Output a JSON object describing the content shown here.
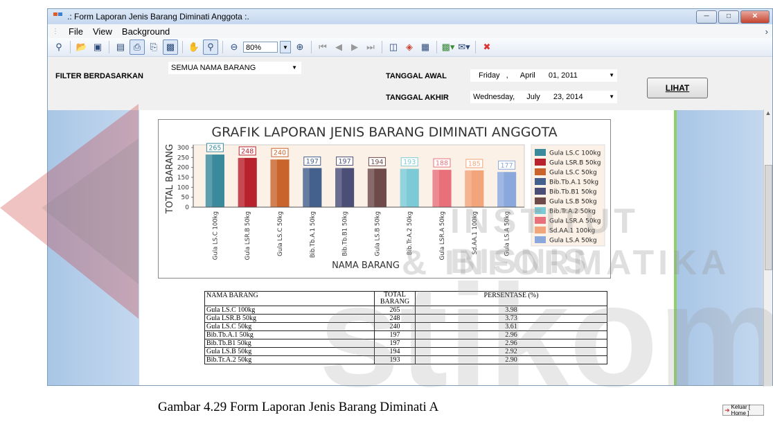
{
  "window": {
    "title": ".: Form Laporan Jenis Barang Diminati Anggota :.",
    "controls": [
      "minimize",
      "maximize",
      "close"
    ]
  },
  "menu": {
    "items": [
      "File",
      "View",
      "Background"
    ]
  },
  "toolbar": {
    "icons": [
      "find-icon",
      "open-icon",
      "save-icon",
      "page-setup-icon",
      "print-icon",
      "quick-print-icon",
      "export-icon",
      "hand-icon",
      "magnifier-icon",
      "zoom-out-icon",
      "zoom-in-icon",
      "first-page-icon",
      "prev-page-icon",
      "next-page-icon",
      "last-page-icon",
      "multiple-pages-icon",
      "background-color-icon",
      "watermark-icon",
      "export-menu-icon",
      "send-icon",
      "close-preview-icon"
    ],
    "zoom": "80%"
  },
  "filter": {
    "label": "FILTER BERDASARKAN",
    "value": "SEMUA NAMA BARANG",
    "start_label": "TANGGAL AWAL",
    "start_day": "Friday",
    "start_comma": ",",
    "start_month": "April",
    "start_date": "01, 2011",
    "end_label": "TANGGAL AKHIR",
    "end_day": "Wednesday,",
    "end_month": "July",
    "end_date": "23, 2014",
    "button": "LIHAT"
  },
  "chart_data": {
    "type": "bar",
    "title": "GRAFIK LAPORAN JENIS BARANG DIMINATI ANGGOTA",
    "xlabel": "NAMA BARANG",
    "ylabel": "TOTAL BARANG",
    "ylim": [
      0,
      300
    ],
    "yticks": [
      "0",
      "50",
      "100",
      "150",
      "200",
      "250",
      "300"
    ],
    "categories": [
      "Gula LS.C 100kg",
      "Gula LSR.B 50kg",
      "Gula LS.C 50kg",
      "Bib.Tb.A.1 50kg",
      "Bib.Tb.B1 50kg",
      "Gula LS.B 50kg",
      "Bib.Tr.A.2 50kg",
      "Gula LSR.A 50kg",
      "Sd.AA.1 100kg",
      "Gula LS.A 50kg"
    ],
    "values": [
      265,
      248,
      240,
      197,
      197,
      194,
      193,
      188,
      185,
      177
    ],
    "colors": [
      "#3a8a9c",
      "#b8222c",
      "#c8642c",
      "#44608c",
      "#4b4f78",
      "#6e4a4a",
      "#7ccad6",
      "#e8707a",
      "#f2a47a",
      "#8aa8dc"
    ],
    "legend": [
      "Gula LS.C 100kg",
      "Gula LSR.B 50kg",
      "Gula LS.C 50kg",
      "Bib.Tb.A.1 50kg",
      "Bib.Tb.B1 50kg",
      "Gula LS.B 50kg",
      "Bib.Tr.A.2 50kg",
      "Gula LSR.A 50kg",
      "Sd.AA.1 100kg",
      "Gula LS.A 50kg"
    ],
    "legend_position": "right",
    "grid": false
  },
  "table": {
    "headers": [
      "NAMA BARANG",
      "TOTAL",
      "BARANG",
      "PERSENTASE (%)"
    ],
    "rows": [
      [
        "Gula LS.C 100kg",
        "265",
        "3.98"
      ],
      [
        "Gula LSR.B 50kg",
        "248",
        "3.73"
      ],
      [
        "Gula LS.C 50kg",
        "240",
        "3.61"
      ],
      [
        "Bib.Tb.A.1 50kg",
        "197",
        "2.96"
      ],
      [
        "Bib.Tb.B1 50kg",
        "197",
        "2.96"
      ],
      [
        "Gula LS.B 50kg",
        "194",
        "2.92"
      ],
      [
        "Bib.Tr.A.2 50kg",
        "193",
        "2.90"
      ]
    ]
  },
  "caption": "Gambar 4.29 Form Laporan Jenis Barang Diminati A",
  "caption_em": "Form",
  "keluar_button": "Keluar [ Home ]",
  "watermark": {
    "line1": "INSTITUT BISNIS",
    "line2": "& INFORMATIKA",
    "logo": "stikom"
  }
}
